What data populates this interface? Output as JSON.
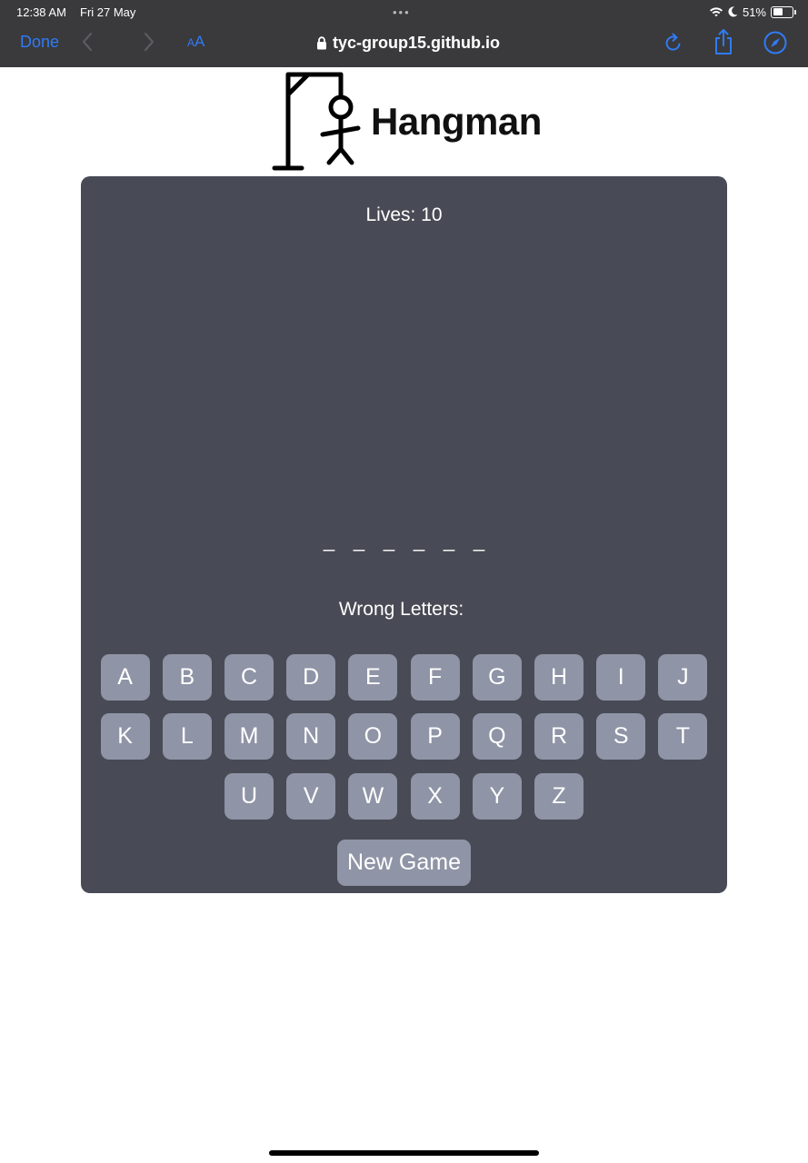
{
  "status_bar": {
    "time": "12:38 AM",
    "date": "Fri 27 May",
    "dots": "•••",
    "battery_percent": "51%",
    "battery_level": 0.51
  },
  "browser": {
    "done_label": "Done",
    "text_size_small": "A",
    "text_size_big": "A",
    "url": "tyc-group15.github.io",
    "accent_color": "#2f7bf6"
  },
  "header": {
    "title": "Hangman"
  },
  "game": {
    "lives_label": "Lives: 10",
    "word_blanks": [
      "_",
      "_",
      "_",
      "_",
      "_",
      "_"
    ],
    "wrong_letters_label": "Wrong Letters:",
    "wrong_letters": "",
    "keyboard_rows": [
      [
        "A",
        "B",
        "C",
        "D",
        "E",
        "F",
        "G",
        "H",
        "I",
        "J"
      ],
      [
        "K",
        "L",
        "M",
        "N",
        "O",
        "P",
        "Q",
        "R",
        "S",
        "T"
      ],
      [
        "U",
        "V",
        "W",
        "X",
        "Y",
        "Z"
      ]
    ],
    "new_game_label": "New Game",
    "panel_color": "#484b55",
    "key_color": "#8f94a6"
  }
}
